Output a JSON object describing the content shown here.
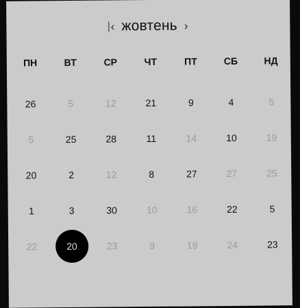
{
  "calendar": {
    "month_title": "жовтень",
    "prev_glyph": "‹",
    "next_glyph": "›",
    "weekdays": [
      "ПН",
      "ВТ",
      "СР",
      "ЧТ",
      "ПТ",
      "СБ",
      "НД"
    ],
    "weeks": [
      [
        {
          "label": "26",
          "muted": false
        },
        {
          "label": "5",
          "muted": true
        },
        {
          "label": "12",
          "muted": true
        },
        {
          "label": "21",
          "muted": false
        },
        {
          "label": "9",
          "muted": false
        },
        {
          "label": "4",
          "muted": false
        },
        {
          "label": "5",
          "muted": true
        }
      ],
      [
        {
          "label": "5",
          "muted": true
        },
        {
          "label": "25",
          "muted": false
        },
        {
          "label": "28",
          "muted": false
        },
        {
          "label": "11",
          "muted": false
        },
        {
          "label": "14",
          "muted": true
        },
        {
          "label": "10",
          "muted": false
        },
        {
          "label": "19",
          "muted": true
        }
      ],
      [
        {
          "label": "20",
          "muted": false
        },
        {
          "label": "2",
          "muted": false
        },
        {
          "label": "12",
          "muted": true
        },
        {
          "label": "8",
          "muted": false
        },
        {
          "label": "27",
          "muted": false
        },
        {
          "label": "27",
          "muted": true
        },
        {
          "label": "25",
          "muted": true
        }
      ],
      [
        {
          "label": "1",
          "muted": false
        },
        {
          "label": "3",
          "muted": false
        },
        {
          "label": "30",
          "muted": false
        },
        {
          "label": "10",
          "muted": true
        },
        {
          "label": "16",
          "muted": true
        },
        {
          "label": "22",
          "muted": false
        },
        {
          "label": "5",
          "muted": false
        }
      ],
      [
        {
          "label": "22",
          "muted": true
        },
        {
          "label": "20",
          "muted": false,
          "selected": true
        },
        {
          "label": "23",
          "muted": true
        },
        {
          "label": "9",
          "muted": true
        },
        {
          "label": "19",
          "muted": true
        },
        {
          "label": "24",
          "muted": true
        },
        {
          "label": "23",
          "muted": false
        }
      ]
    ]
  }
}
